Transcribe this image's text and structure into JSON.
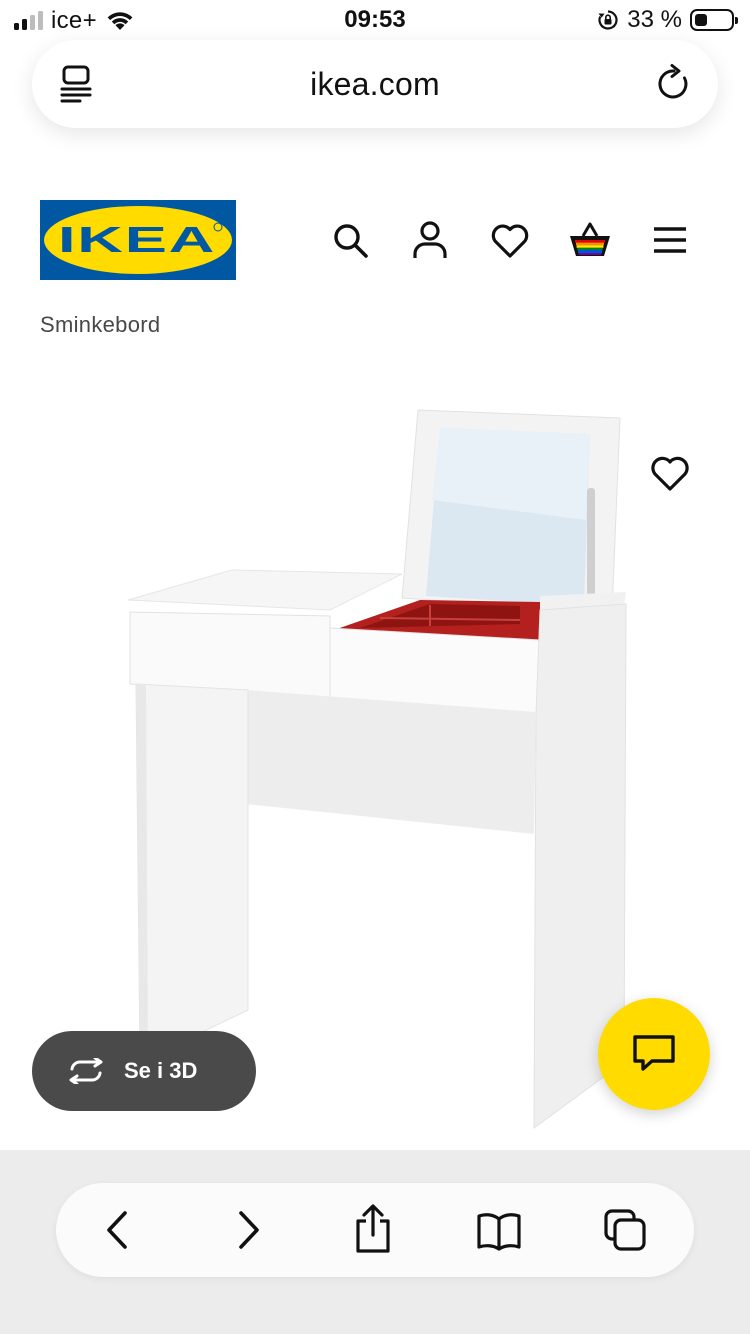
{
  "status_bar": {
    "carrier": "ice+",
    "time": "09:53",
    "battery_percent": "33 %",
    "battery_level": 0.33,
    "signal_bars_active": 2
  },
  "browser": {
    "url": "ikea.com"
  },
  "brand": {
    "logo_text": "IKEA",
    "logo_blue": "#0058a3",
    "logo_yellow": "#ffdb00"
  },
  "header": {
    "icons": [
      "search-icon",
      "account-icon",
      "heart-icon",
      "shopping-bag-icon",
      "menu-icon"
    ]
  },
  "breadcrumb": "Sminkebord",
  "product": {
    "view_3d_label": "Se i 3D",
    "favourite_icon": "heart-icon"
  },
  "chat": {
    "icon": "chat-icon",
    "color": "#ffdb00"
  },
  "toolbar": {
    "icons": [
      "back-icon",
      "forward-icon",
      "share-icon",
      "bookmarks-icon",
      "tabs-icon"
    ]
  }
}
